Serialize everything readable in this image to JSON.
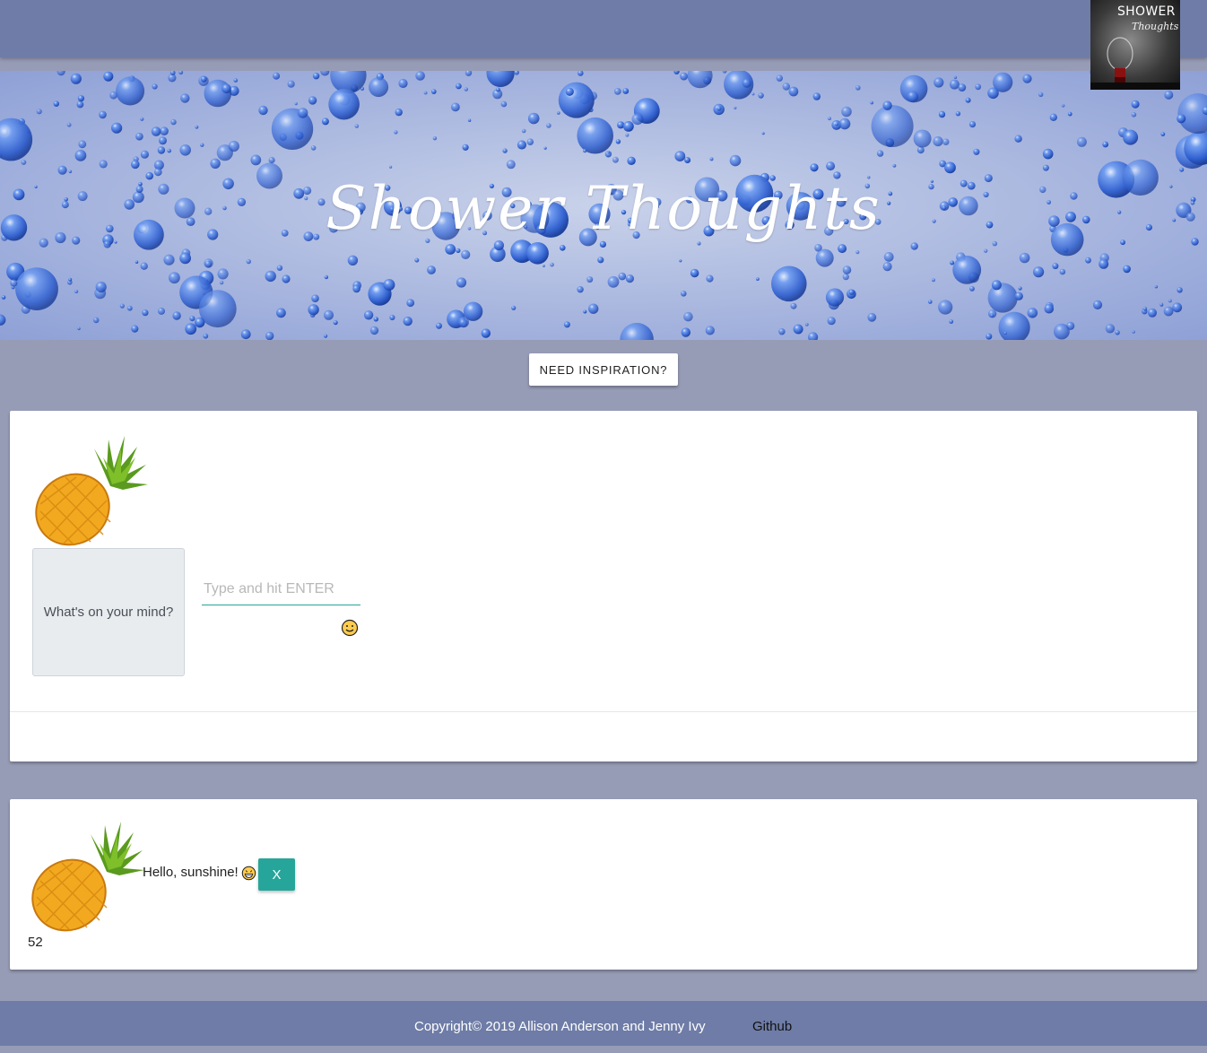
{
  "header": {
    "logo": {
      "line1": "SHOWER",
      "line2": "Thoughts"
    }
  },
  "hero": {
    "title": "Shower Thoughts"
  },
  "inspire_button": {
    "label": "NEED INSPIRATION?"
  },
  "composer": {
    "prompt_label": "What's on your mind?",
    "input_placeholder": "Type and hit ENTER",
    "input_value": "",
    "avatar_icon": "pineapple-icon",
    "emoji_picker_icon": "smiley-face-icon"
  },
  "posts": [
    {
      "text": "Hello, sunshine!",
      "emoji_icon": "grinning-face-icon",
      "delete_label": "X",
      "count": "52",
      "avatar_icon": "pineapple-icon"
    }
  ],
  "footer": {
    "copyright": "Copyright© 2019 Allison Anderson and Jenny Ivy",
    "github_label": "Github"
  },
  "colors": {
    "navbar": "#6e7ca7",
    "page_background": "#979cb6",
    "accent_teal": "#26a69a"
  }
}
